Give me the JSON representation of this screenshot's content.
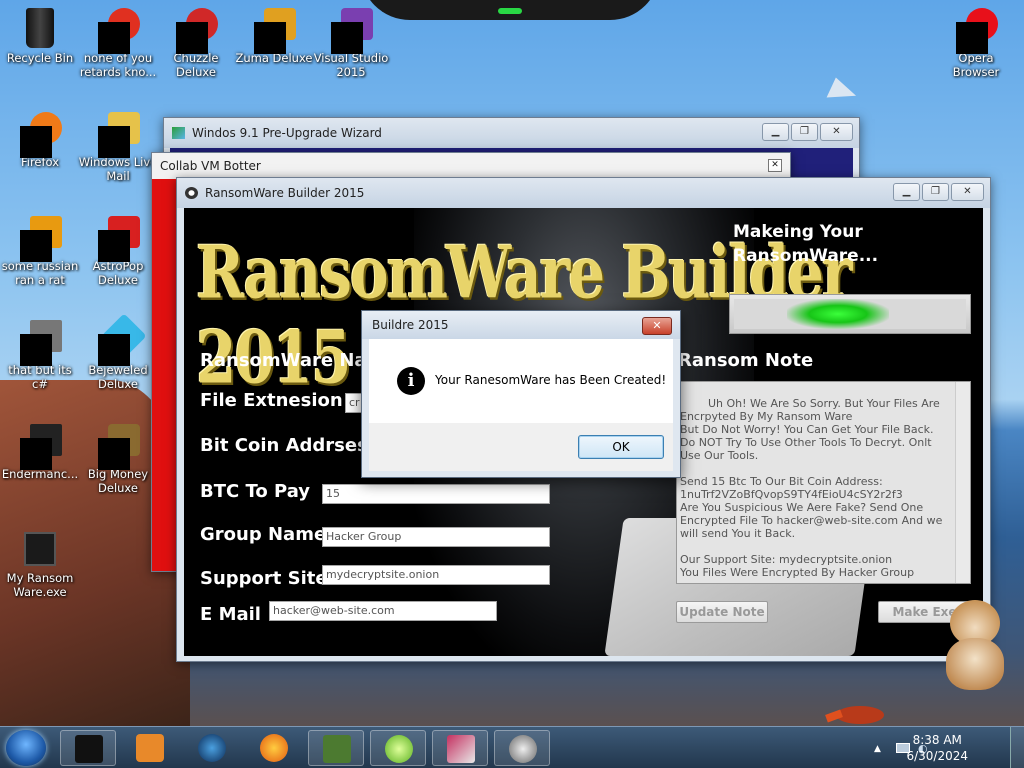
{
  "desktop_icons": [
    {
      "label": "Recycle Bin",
      "icon": "recycle-bin-icon"
    },
    {
      "label": "none of you retards kno...",
      "icon": "generic-app-icon"
    },
    {
      "label": "Chuzzle Deluxe",
      "icon": "chuzzle-icon"
    },
    {
      "label": "Zuma Deluxe",
      "icon": "zuma-icon"
    },
    {
      "label": "Visual Studio 2015",
      "icon": "visual-studio-icon"
    },
    {
      "label": "Opera Browser",
      "icon": "opera-icon"
    },
    {
      "label": "Firefox",
      "icon": "firefox-icon"
    },
    {
      "label": "Windows Live Mail",
      "icon": "mail-icon"
    },
    {
      "label": "some russian ran a rat",
      "icon": "generic-app-icon"
    },
    {
      "label": "AstroPop Deluxe",
      "icon": "astropop-icon"
    },
    {
      "label": "that but its c#",
      "icon": "generic-app-icon"
    },
    {
      "label": "Bejeweled Deluxe",
      "icon": "bejeweled-icon"
    },
    {
      "label": "Endermanc...",
      "icon": "generic-app-icon"
    },
    {
      "label": "Big Money Deluxe",
      "icon": "bigmoney-icon"
    },
    {
      "label": "My Ransom Ware.exe",
      "icon": "exe-icon"
    }
  ],
  "windows": {
    "wizard": {
      "title": "Windos 9.1 Pre-Upgrade Wizard"
    },
    "botter": {
      "title": "Collab VM Botter"
    },
    "builder": {
      "title": "RansomWare Builder 2015",
      "logo": "RansomWare Builder 2015",
      "status": "Makeing Your RansomWare...",
      "progress": 0.45,
      "labels": {
        "name": "RansomWare Nam",
        "ext": "File Extnesion",
        "btc_addr": "Bit Coin Addrses",
        "btc_pay": "BTC To Pay",
        "group": "Group Name",
        "site": "Support Site",
        "email": "E Mail",
        "note": "Ransom Note"
      },
      "fields": {
        "ext": "cr",
        "btc_pay": "15",
        "group": "Hacker Group",
        "site": "mydecryptsite.onion",
        "email": "hacker@web-site.com"
      },
      "note_text": "Uh Oh! We Are So Sorry. But Your Files Are Encrpyted By My Ransom Ware\nBut Do Not Worry! You Can Get Your File Back.\nDo NOT Try To Use Other Tools To Decryt. Onlt Use Our Tools.\n\nSend 15 Btc To Our Bit Coin Address:\n1nuTrf2VZoBfQvopS9TY4fEioU4cSY2r2f3\nAre You Suspicious We Aere Fake? Send One Encrypted File To hacker@web-site.com And we will send You it Back.\n\nOur Support Site: mydecryptsite.onion\nYou Files Were Encrypted By Hacker Group",
      "update_btn": "Update Note",
      "make_btn": "Make Exe"
    }
  },
  "dialog": {
    "title": "Buildre 2015",
    "message": "Your RanesomWare has Been Created!",
    "ok": "OK"
  },
  "taskbar": {
    "time": "8:38 AM",
    "date": "6/30/2024"
  },
  "colors": {
    "progress_green": "#17c517",
    "logo_gold": "#e8d46a",
    "note_bg": "#e4e4e4"
  }
}
